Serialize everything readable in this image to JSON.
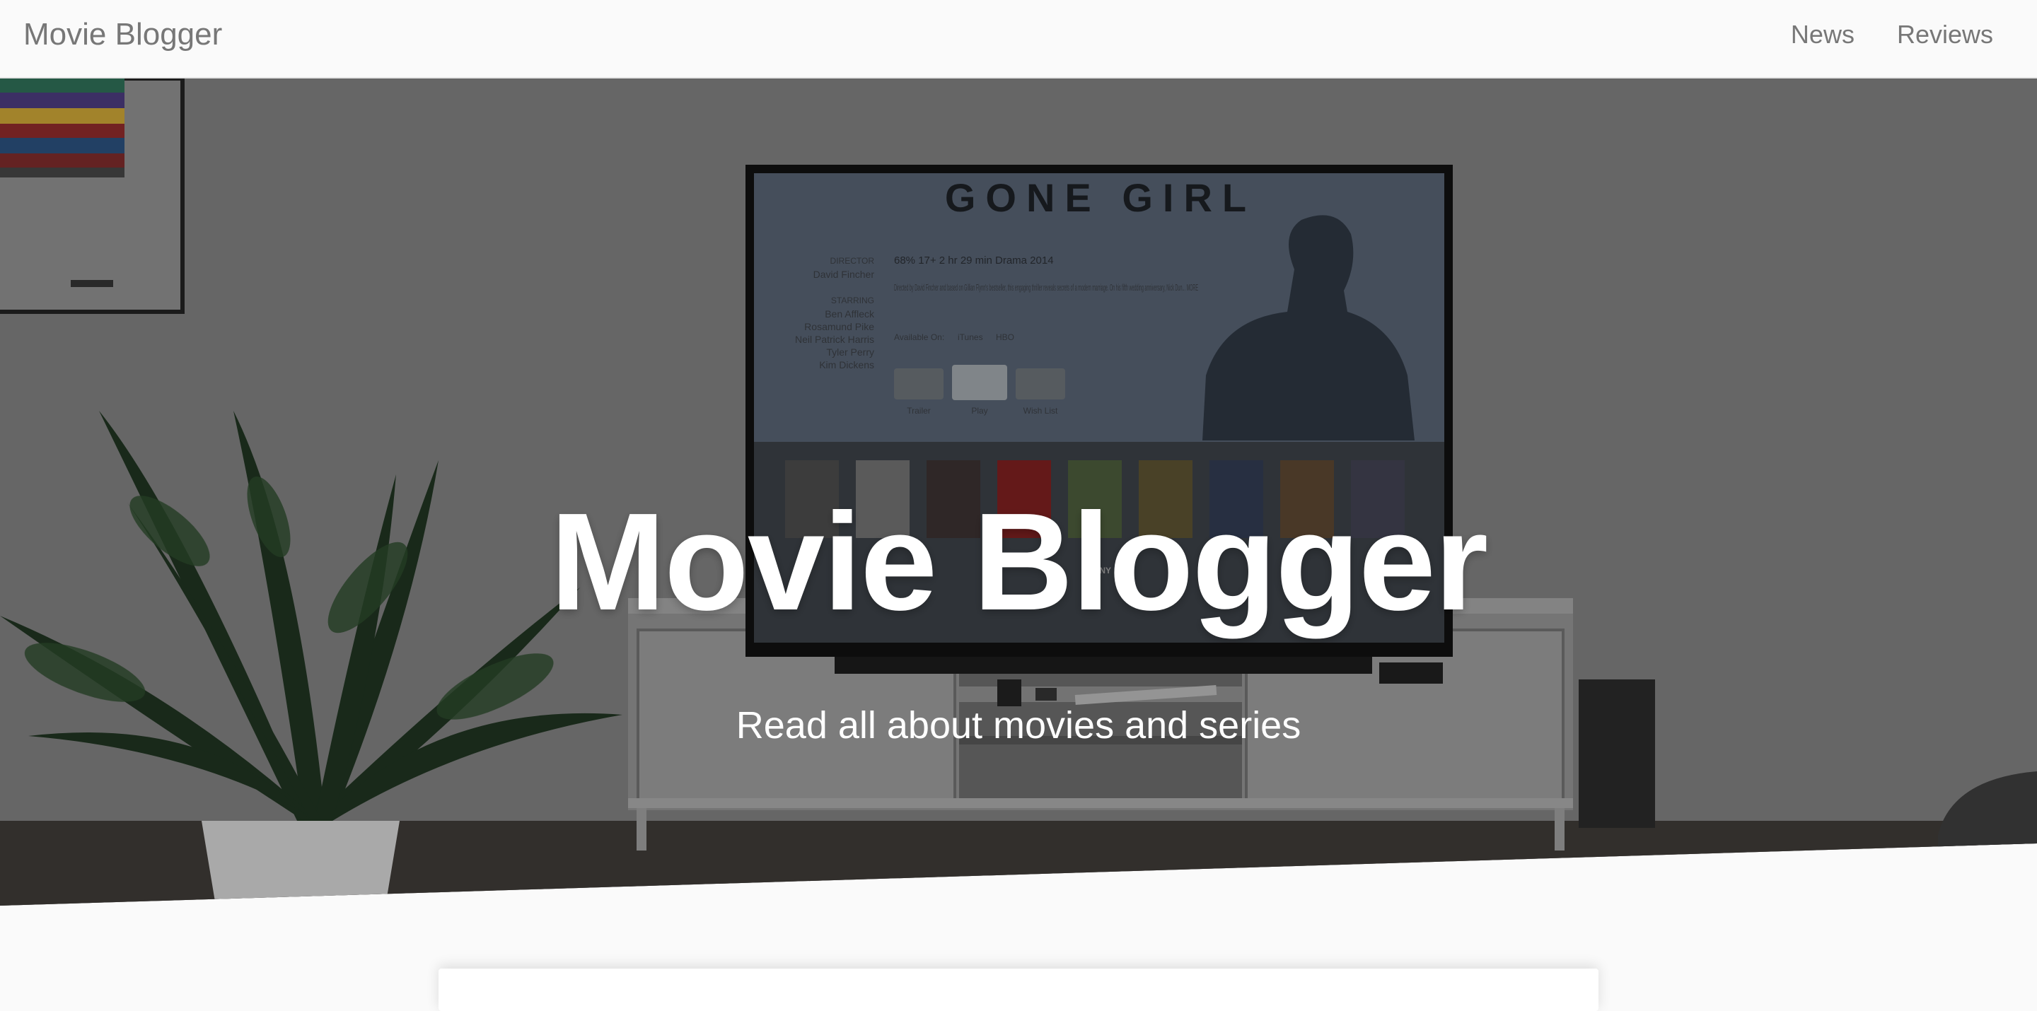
{
  "navbar": {
    "brand": "Movie Blogger",
    "links": [
      {
        "label": "News"
      },
      {
        "label": "Reviews"
      }
    ]
  },
  "hero": {
    "title": "Movie Blogger",
    "subtitle": "Read all about movies and series",
    "background_image_description_icon": "living-room-tv-photo"
  },
  "tv_screen": {
    "movie_title": "GONE GIRL",
    "meta": "68%  17+  2 hr 29 min  Drama  2014",
    "director_label": "DIRECTOR",
    "director": "David Fincher",
    "starring_label": "STARRING",
    "cast": [
      "Ben Affleck",
      "Rosamund Pike",
      "Neil Patrick Harris",
      "Tyler Perry",
      "Kim Dickens"
    ],
    "description": "Directed by David Fincher and based on Gillian Flynn's bestseller, this engaging thriller reveals secrets of a modern marriage. On his fifth wedding anniversary, Nick Dun... MORE",
    "available_on": "Available On:",
    "providers": [
      "iTunes",
      "HBO"
    ],
    "buttons": [
      "Trailer",
      "Play",
      "Wish List"
    ],
    "brand": "SONY"
  },
  "colors": {
    "navbar_bg": "#fafafa",
    "nav_text": "#777777",
    "hero_text": "#ffffff",
    "page_bg": "#fafafa"
  }
}
